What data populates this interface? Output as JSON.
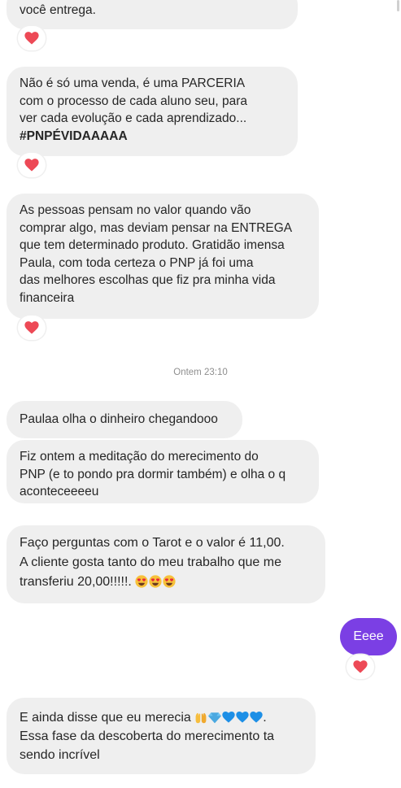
{
  "colors": {
    "received_bubble": "#efefef",
    "sent_bubble": "#7b3fe4",
    "reaction_heart": "#ed4956",
    "timestamp": "#8e8e8e"
  },
  "thread": {
    "messages": [
      {
        "lines": [
          "você entrega."
        ],
        "reaction": "heart-icon"
      },
      {
        "lines": [
          "Não é só uma venda, é uma PARCERIA",
          "com o processo de cada aluno seu, para",
          "ver cada evolução e cada aprendizado...",
          "#PNPÉVIDAAAAA"
        ],
        "reaction": "heart-icon"
      },
      {
        "lines": [
          "As pessoas pensam no valor quando vão",
          "comprar algo, mas deviam pensar na ENTREGA",
          "que tem determinado produto. Gratidão imensa",
          "Paula, com toda certeza o PNP já foi uma",
          "das melhores escolhas que fiz pra minha vida",
          "financeira"
        ],
        "reaction": "heart-icon"
      },
      {
        "lines": [
          "Paulaa olha o dinheiro chegandooo"
        ]
      },
      {
        "lines": [
          "Fiz ontem a meditação do merecimento do",
          "PNP (e to pondo pra dormir também) e olha o q",
          "aconteceeeeu"
        ]
      },
      {
        "lines": [
          "Faço perguntas com o Tarot e o valor é 11,00.",
          "A cliente gosta tanto do meu trabalho que me",
          "transferiu 20,00!!!!!."
        ],
        "emojis": [
          "heart-eyes-emoji",
          "heart-eyes-emoji",
          "heart-eyes-emoji"
        ]
      },
      {
        "lines": [
          "E ainda disse que eu merecia",
          ".",
          "Essa fase da descoberta do merecimento ta",
          "sendo incrível"
        ],
        "emojis": [
          "raised-hands-emoji",
          "gem-emoji",
          "blue-heart-emoji",
          "blue-heart-emoji",
          "blue-heart-emoji"
        ]
      }
    ],
    "timestamp": "Ontem 23:10",
    "sent_message": {
      "text": "Eeee",
      "reaction": "heart-icon"
    }
  }
}
